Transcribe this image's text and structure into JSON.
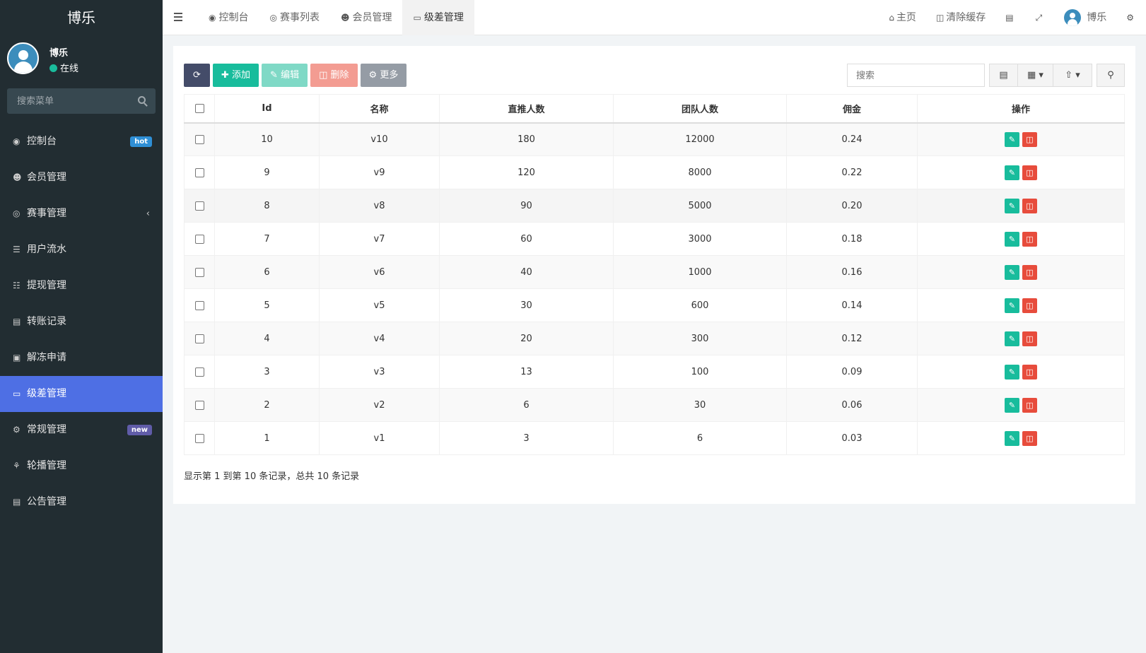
{
  "sidebar": {
    "brand": "博乐",
    "user_name": "博乐",
    "user_status": "在线",
    "search_placeholder": "搜索菜单",
    "items": [
      {
        "label": "控制台",
        "icon": "dashboard-icon",
        "badge": "hot"
      },
      {
        "label": "会员管理",
        "icon": "users-icon"
      },
      {
        "label": "赛事管理",
        "icon": "globe-icon",
        "chevron": true
      },
      {
        "label": "用户流水",
        "icon": "list-icon"
      },
      {
        "label": "提现管理",
        "icon": "list-alt-icon"
      },
      {
        "label": "转账记录",
        "icon": "transfer-icon"
      },
      {
        "label": "解冻申请",
        "icon": "image-icon"
      },
      {
        "label": "级差管理",
        "icon": "window-icon",
        "active": true
      },
      {
        "label": "常规管理",
        "icon": "cogs-icon",
        "badge": "new"
      },
      {
        "label": "轮播管理",
        "icon": "carousel-icon"
      },
      {
        "label": "公告管理",
        "icon": "notice-icon"
      }
    ]
  },
  "topbar": {
    "tabs": [
      {
        "label": "控制台",
        "icon": "dashboard-icon"
      },
      {
        "label": "赛事列表",
        "icon": "globe-icon"
      },
      {
        "label": "会员管理",
        "icon": "users-icon"
      },
      {
        "label": "级差管理",
        "icon": "window-icon",
        "active": true
      }
    ],
    "home_label": "主页",
    "clear_cache_label": "清除缓存",
    "user_label": "博乐"
  },
  "toolbar": {
    "add_label": "添加",
    "edit_label": "编辑",
    "delete_label": "删除",
    "more_label": "更多",
    "search_placeholder": "搜索"
  },
  "table": {
    "headers": [
      "Id",
      "名称",
      "直推人数",
      "团队人数",
      "佣金",
      "操作"
    ],
    "rows": [
      [
        "10",
        "v10",
        "180",
        "12000",
        "0.24"
      ],
      [
        "9",
        "v9",
        "120",
        "8000",
        "0.22"
      ],
      [
        "8",
        "v8",
        "90",
        "5000",
        "0.20"
      ],
      [
        "7",
        "v7",
        "60",
        "3000",
        "0.18"
      ],
      [
        "6",
        "v6",
        "40",
        "1000",
        "0.16"
      ],
      [
        "5",
        "v5",
        "30",
        "600",
        "0.14"
      ],
      [
        "4",
        "v4",
        "20",
        "300",
        "0.12"
      ],
      [
        "3",
        "v3",
        "13",
        "100",
        "0.09"
      ],
      [
        "2",
        "v2",
        "6",
        "30",
        "0.06"
      ],
      [
        "1",
        "v1",
        "3",
        "6",
        "0.03"
      ]
    ]
  },
  "pager_text": "显示第 1 到第 10 条记录，总共 10 条记录"
}
